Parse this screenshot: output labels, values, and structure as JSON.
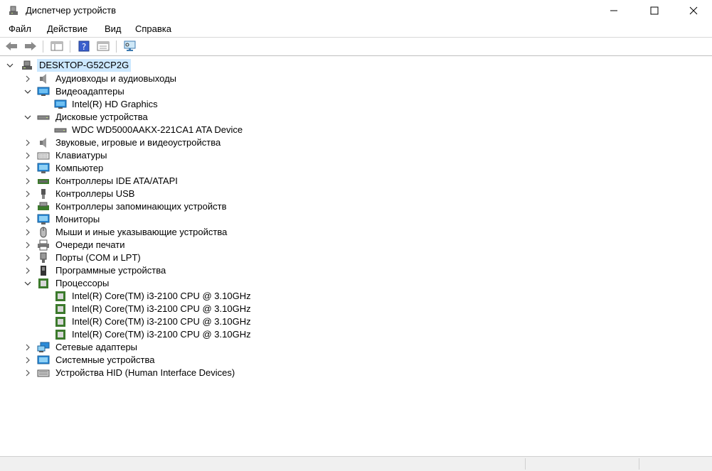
{
  "window": {
    "title": "Диспетчер устройств"
  },
  "menu": [
    "Файл",
    "Действие",
    "Вид",
    "Справка"
  ],
  "toolbar": {
    "buttons": [
      "back-icon",
      "forward-icon",
      "show-hide-tree-icon",
      "help-icon",
      "properties-icon",
      "scan-hardware-icon"
    ]
  },
  "tree": {
    "root": "DESKTOP-G52CP2G",
    "categories": [
      {
        "label": "Аудиовходы и аудиовыходы",
        "icon": "speaker-icon",
        "expanded": false
      },
      {
        "label": "Видеоадаптеры",
        "icon": "display-adapter-icon",
        "expanded": true,
        "children": [
          "Intel(R) HD Graphics"
        ]
      },
      {
        "label": "Дисковые устройства",
        "icon": "disk-drive-icon",
        "expanded": true,
        "children": [
          "WDC WD5000AAKX-221CA1 ATA Device"
        ]
      },
      {
        "label": "Звуковые, игровые и видеоустройства",
        "icon": "sound-icon",
        "expanded": false
      },
      {
        "label": "Клавиатуры",
        "icon": "keyboard-icon",
        "expanded": false
      },
      {
        "label": "Компьютер",
        "icon": "computer-icon",
        "expanded": false
      },
      {
        "label": "Контроллеры IDE ATA/ATAPI",
        "icon": "ide-controller-icon",
        "expanded": false
      },
      {
        "label": "Контроллеры USB",
        "icon": "usb-icon",
        "expanded": false
      },
      {
        "label": "Контроллеры запоминающих устройств",
        "icon": "storage-controller-icon",
        "expanded": false
      },
      {
        "label": "Мониторы",
        "icon": "monitor-icon",
        "expanded": false
      },
      {
        "label": "Мыши и иные указывающие устройства",
        "icon": "mouse-icon",
        "expanded": false
      },
      {
        "label": "Очереди печати",
        "icon": "printer-icon",
        "expanded": false
      },
      {
        "label": "Порты (COM и LPT)",
        "icon": "port-icon",
        "expanded": false
      },
      {
        "label": "Программные устройства",
        "icon": "software-device-icon",
        "expanded": false
      },
      {
        "label": "Процессоры",
        "icon": "processor-icon",
        "expanded": true,
        "children": [
          "Intel(R) Core(TM) i3-2100 CPU @ 3.10GHz",
          "Intel(R) Core(TM) i3-2100 CPU @ 3.10GHz",
          "Intel(R) Core(TM) i3-2100 CPU @ 3.10GHz",
          "Intel(R) Core(TM) i3-2100 CPU @ 3.10GHz"
        ]
      },
      {
        "label": "Сетевые адаптеры",
        "icon": "network-adapter-icon",
        "expanded": false
      },
      {
        "label": "Системные устройства",
        "icon": "system-device-icon",
        "expanded": false
      },
      {
        "label": "Устройства HID (Human Interface Devices)",
        "icon": "hid-icon",
        "expanded": false
      }
    ]
  },
  "colors": {
    "selection": "#cce8ff",
    "processor": "#3c7a2c",
    "adapter": "#2a8bd8"
  }
}
